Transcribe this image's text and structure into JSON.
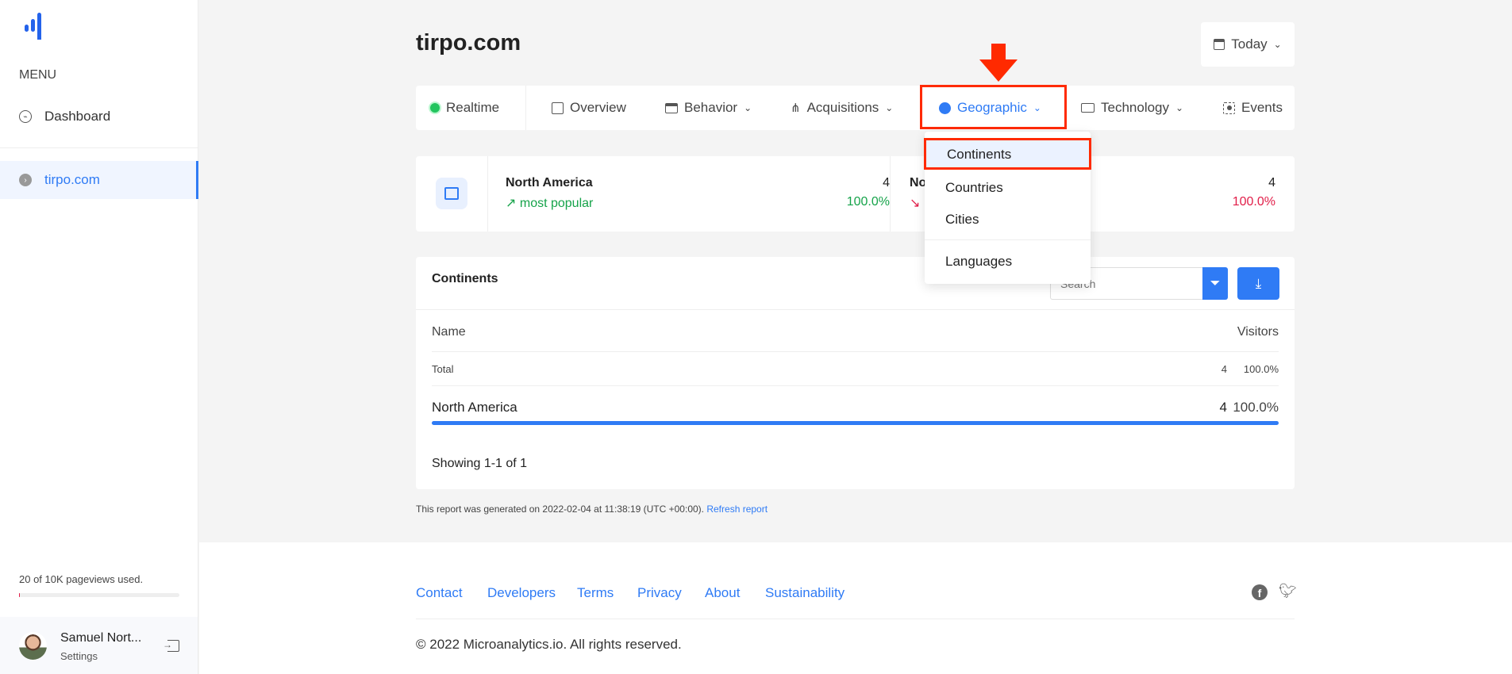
{
  "sidebar": {
    "menu_label": "MENU",
    "items": [
      {
        "label": "Dashboard",
        "icon": "gauge-icon"
      },
      {
        "label": "tirpo.com",
        "icon": "chevron-circle-icon",
        "active": true
      }
    ],
    "usage": {
      "text": "20 of 10K pageviews used.",
      "fraction": 0.002
    },
    "user": {
      "name": "Samuel Nort...",
      "sub": "Settings"
    }
  },
  "header": {
    "title": "tirpo.com",
    "date_range": "Today"
  },
  "nav": {
    "realtime": "Realtime",
    "overview": "Overview",
    "behavior": "Behavior",
    "acquisitions": "Acquisitions",
    "geographic": "Geographic",
    "technology": "Technology",
    "events": "Events"
  },
  "dropdown": {
    "items": [
      "Continents",
      "Countries",
      "Cities",
      "Languages"
    ],
    "selected": "Continents"
  },
  "stats": {
    "top": {
      "name": "North America",
      "label": "most popular",
      "value": "4",
      "percent": "100.0%"
    },
    "bottom": {
      "name": "No",
      "value": "4",
      "percent": "100.0%"
    }
  },
  "table": {
    "title": "Continents",
    "search_placeholder": "Search",
    "col_name": "Name",
    "col_visitors": "Visitors",
    "total": {
      "label": "Total",
      "value": "4",
      "percent": "100.0%"
    },
    "rows": [
      {
        "name": "North America",
        "value": "4",
        "percent": "100.0%",
        "fraction": 1.0
      }
    ],
    "showing": "Showing 1-1 of 1"
  },
  "report": {
    "text": "This report was generated on 2022-02-04 at 11:38:19 (UTC +00:00).",
    "refresh": "Refresh report"
  },
  "footer": {
    "links": [
      "Contact",
      "Developers",
      "Terms",
      "Privacy",
      "About",
      "Sustainability"
    ],
    "copyright": "© 2022 Microanalytics.io. All rights reserved."
  },
  "colors": {
    "accent": "#2f7bf5",
    "highlight": "#ff2a00",
    "positive": "#16a34a",
    "negative": "#e11d48"
  }
}
